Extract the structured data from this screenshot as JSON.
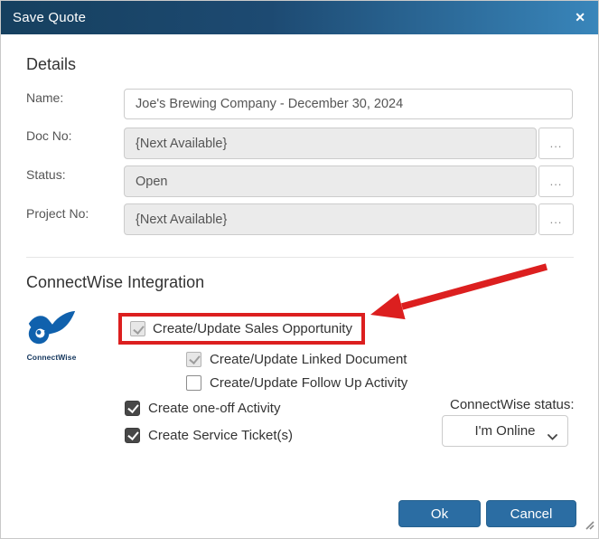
{
  "dialog": {
    "title": "Save Quote",
    "close_icon": "✕"
  },
  "details": {
    "heading": "Details",
    "name_label": "Name:",
    "name_value": "Joe's Brewing Company - December 30, 2024",
    "doc_no_label": "Doc No:",
    "doc_no_value": "{Next Available}",
    "status_label": "Status:",
    "status_value": "Open",
    "project_no_label": "Project No:",
    "project_no_value": "{Next Available}",
    "browse_button_label": "..."
  },
  "integration": {
    "heading": "ConnectWise Integration",
    "logo_text": "ConnectWise",
    "checkboxes": [
      {
        "label": "Create/Update Sales Opportunity",
        "state": "checked-disabled",
        "highlighted": true
      },
      {
        "label": "Create/Update Linked Document",
        "state": "checked-disabled",
        "highlighted": false
      },
      {
        "label": "Create/Update Follow Up Activity",
        "state": "unchecked",
        "highlighted": false
      },
      {
        "label": "Create one-off Activity",
        "state": "checked",
        "highlighted": false
      },
      {
        "label": "Create Service Ticket(s)",
        "state": "checked",
        "highlighted": false
      }
    ],
    "status_label": "ConnectWise status:",
    "status_value": "I'm Online"
  },
  "footer": {
    "ok_label": "Ok",
    "cancel_label": "Cancel"
  },
  "colors": {
    "header_gradient_start": "#16405f",
    "header_gradient_end": "#3986bb",
    "button_blue": "#2b6da3",
    "highlight_red": "#dc1f1f",
    "logo_blue": "#1061ad",
    "disabled_input_bg": "#ebebeb"
  }
}
